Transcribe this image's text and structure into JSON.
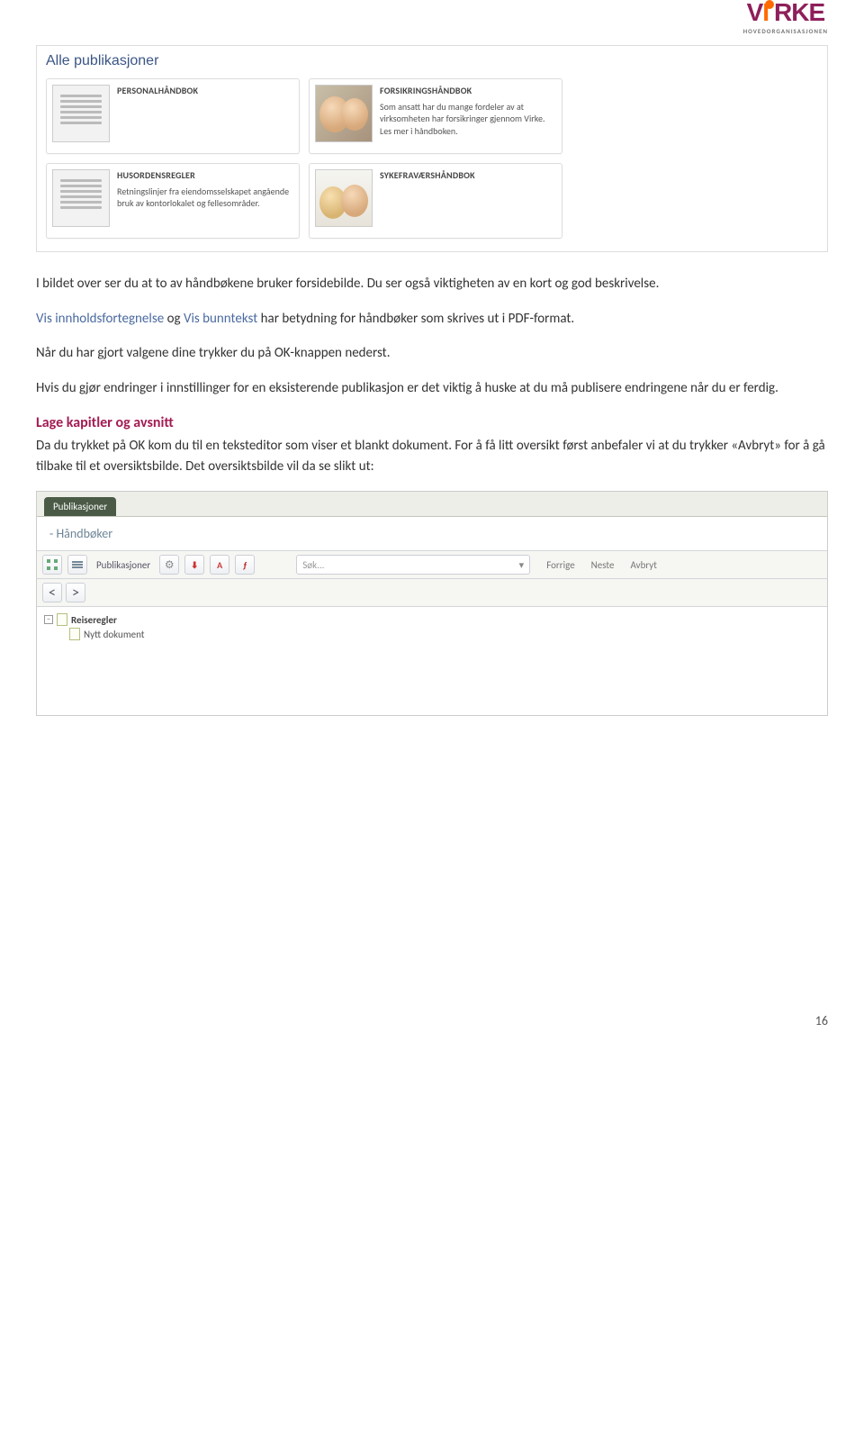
{
  "logo": {
    "text_v": "V",
    "text_i": "I",
    "text_rke": "RKE",
    "subtitle": "HOVEDORGANISASJONEN"
  },
  "shot1": {
    "heading": "Alle publikasjoner",
    "cards": [
      {
        "title": "PERSONALHÅNDBOK",
        "desc": "",
        "thumb": "doc"
      },
      {
        "title": "FORSIKRINGSHÅNDBOK",
        "desc": "Som ansatt har du mange fordeler av at virksomheten har forsikringer gjennom Virke. Les mer i håndboken.",
        "thumb": "photo"
      },
      {
        "title": "HUSORDENSREGLER",
        "desc": "Retningslinjer fra eiendomsselskapet angående bruk av kontorlokalet og fellesområder.",
        "thumb": "doc"
      },
      {
        "title": "SYKEFRAVÆRSHÅNDBOK",
        "desc": "",
        "thumb": "photo2"
      }
    ]
  },
  "body": {
    "p1": "I bildet over ser du at to av håndbøkene bruker forsidebilde. Du ser også viktigheten av en kort og god beskrivelse.",
    "p2a": "Vis innholdsfortegnelse",
    "p2mid": " og ",
    "p2b": "Vis bunntekst",
    "p2rest": " har betydning for håndbøker som skrives ut i PDF-format.",
    "p3": "Når du har gjort valgene dine trykker du på OK-knappen nederst.",
    "p4": "Hvis du gjør endringer i innstillinger for en eksisterende publikasjon er det viktig å huske at du må publisere endringene når du er ferdig.",
    "h3": "Lage kapitler og avsnitt",
    "p5": "Da du trykket på OK kom du til en teksteditor som viser et blankt dokument. For å få litt oversikt først anbefaler vi at du trykker «Avbryt» for å gå tilbake til et oversiktsbilde. Det oversiktsbilde vil da se slikt ut:"
  },
  "shot2": {
    "tab": "Publikasjoner",
    "subhead": "- Håndbøker",
    "toolbar": {
      "listlabel": "Publikasjoner",
      "search_placeholder": "Søk...",
      "prev": "Forrige",
      "next": "Neste",
      "cancel": "Avbryt"
    },
    "nav": {
      "back": "<",
      "fwd": ">"
    },
    "tree": {
      "root": "Reiseregler",
      "child": "Nytt dokument"
    }
  },
  "page_number": "16"
}
